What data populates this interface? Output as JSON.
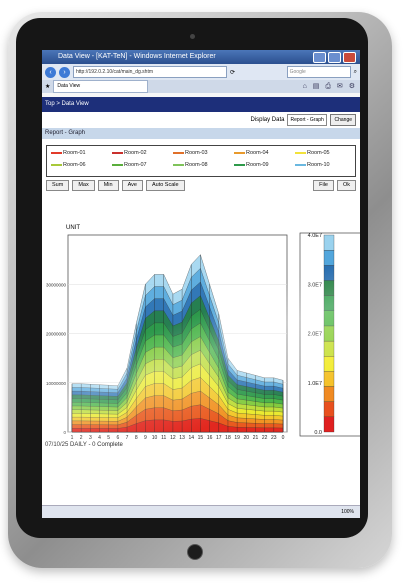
{
  "browser": {
    "window_title": "Data View - [KAT-TeN] - Windows Internet Explorer",
    "url": "http://192.0.2.10/cat/main_dg.shtm",
    "search_placeholder": "Google",
    "tab_label": "Data View"
  },
  "page": {
    "breadcrumb": "Top > Data View",
    "display_label": "Display Data",
    "display_select": "Report - Graph",
    "change_button": "Change",
    "section_title": "Report - Graph"
  },
  "legend": [
    {
      "name": "Room-01",
      "color": "#e23b2a"
    },
    {
      "name": "Room-02",
      "color": "#c9302c"
    },
    {
      "name": "Room-03",
      "color": "#e0702a"
    },
    {
      "name": "Room-04",
      "color": "#e89a2c"
    },
    {
      "name": "Room-05",
      "color": "#f2e23a"
    },
    {
      "name": "Room-06",
      "color": "#a8c93a"
    },
    {
      "name": "Room-07",
      "color": "#5aae3c"
    },
    {
      "name": "Room-08",
      "color": "#7fc35a"
    },
    {
      "name": "Room-09",
      "color": "#2e9a4a"
    },
    {
      "name": "Room-10",
      "color": "#6ab8e0"
    }
  ],
  "scale_buttons": {
    "sum": "Sum",
    "max": "Max",
    "min": "Min",
    "ave": "Ave",
    "auto": "Auto Scale",
    "file": "File",
    "ok": "Ok"
  },
  "icons": {
    "back": "back-arrow-icon",
    "forward": "forward-arrow-icon",
    "refresh": "refresh-icon",
    "search": "search-icon"
  },
  "footer_text": "07/10/25 DAILY - 0 Complete",
  "status_text": "100%",
  "chart_data": {
    "type": "area",
    "title": "",
    "ylabel": "UNIT",
    "x": [
      "1",
      "2",
      "3",
      "4",
      "5",
      "6",
      "7",
      "8",
      "9",
      "10",
      "11",
      "12",
      "13",
      "14",
      "15",
      "16",
      "17",
      "18",
      "19",
      "20",
      "21",
      "22",
      "23",
      "0"
    ],
    "ylim": [
      0,
      40000000
    ],
    "y_ticks": [
      "0",
      "10000000",
      "20000000",
      "30000000"
    ],
    "total_values": [
      9800000,
      9800000,
      9700000,
      9600000,
      9500000,
      9400000,
      13000000,
      22000000,
      30000000,
      32000000,
      32000000,
      28000000,
      29000000,
      34000000,
      36000000,
      30000000,
      24000000,
      15000000,
      12500000,
      12000000,
      11500000,
      11000000,
      11000000,
      10500000
    ],
    "stack_series_count": 13,
    "colorbar": {
      "ticks": [
        "0.0",
        "1.0E7",
        "2.0E7",
        "3.0E7",
        "4.0E7"
      ],
      "colors": [
        "#e02020",
        "#e8501e",
        "#f08a22",
        "#f5c22a",
        "#f2ec30",
        "#c8e03a",
        "#8ccf3e",
        "#4fb848",
        "#2f9d4a",
        "#248040",
        "#2a6fb0",
        "#52a6dc",
        "#9ad2ee"
      ]
    }
  }
}
